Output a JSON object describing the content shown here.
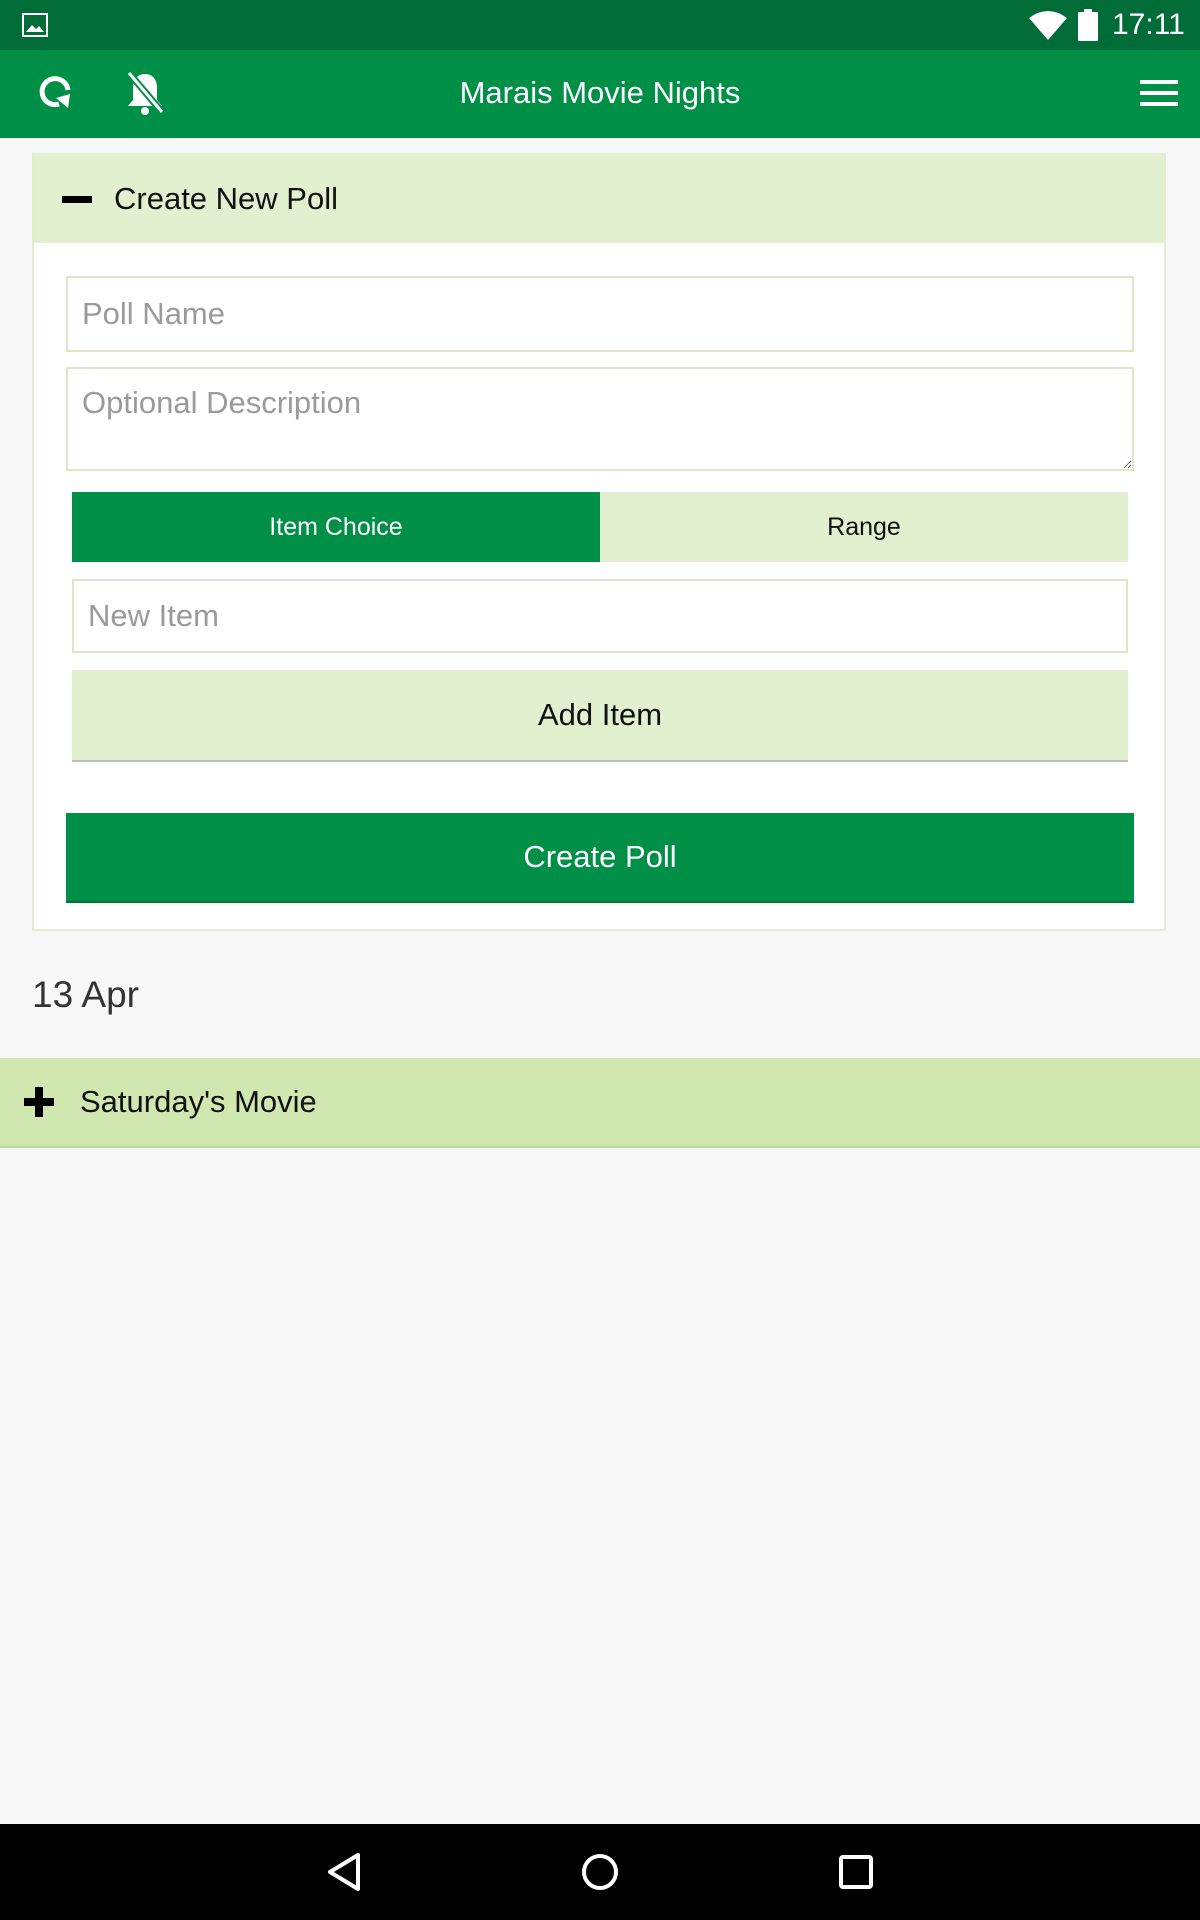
{
  "status_bar": {
    "time": "17:11"
  },
  "app_bar": {
    "title": "Marais Movie Nights"
  },
  "create_poll": {
    "header": "Create New Poll",
    "poll_name_placeholder": "Poll Name",
    "description_placeholder": "Optional Description",
    "tabs": [
      {
        "label": "Item Choice",
        "selected": true
      },
      {
        "label": "Range",
        "selected": false
      }
    ],
    "new_item_placeholder": "New Item",
    "add_item_label": "Add Item",
    "create_label": "Create Poll"
  },
  "polls": {
    "date": "13 Apr",
    "items": [
      {
        "title": "Saturday's Movie"
      }
    ]
  },
  "colors": {
    "primary": "#008f46",
    "status_bar": "#006c37",
    "light_green": "#e2f0d0",
    "row_green": "#d0e8b0"
  }
}
